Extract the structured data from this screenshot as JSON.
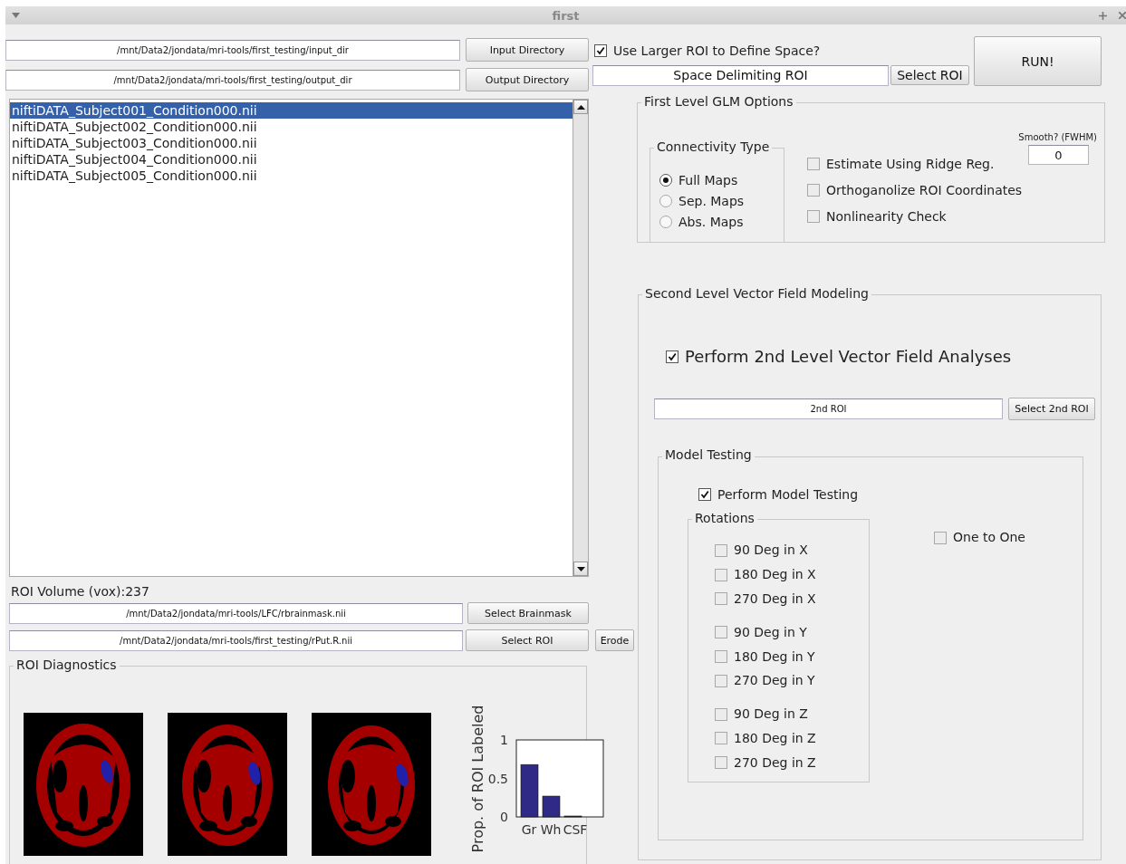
{
  "window": {
    "title": "first"
  },
  "input_dir": {
    "value": "/mnt/Data2/jondata/mri-tools/first_testing/input_dir",
    "button": "Input Directory"
  },
  "output_dir": {
    "value": "/mnt/Data2/jondata/mri-tools/first_testing/output_dir",
    "button": "Output Directory"
  },
  "file_list": {
    "items": [
      {
        "label": "niftiDATA_Subject001_Condition000.nii",
        "selected": true
      },
      {
        "label": "niftiDATA_Subject002_Condition000.nii",
        "selected": false
      },
      {
        "label": "niftiDATA_Subject003_Condition000.nii",
        "selected": false
      },
      {
        "label": "niftiDATA_Subject004_Condition000.nii",
        "selected": false
      },
      {
        "label": "niftiDATA_Subject005_Condition000.nii",
        "selected": false
      }
    ]
  },
  "roi_volume": "ROI Volume (vox):237",
  "brainmask": {
    "value": "/mnt/Data2/jondata/mri-tools/LFC/rbrainmask.nii",
    "button": "Select Brainmask"
  },
  "roi": {
    "value": "/mnt/Data2/jondata/mri-tools/first_testing/rPut.R.nii",
    "button": "Select ROI",
    "erode_button": "Erode"
  },
  "roi_diagnostics": {
    "title": "ROI Diagnostics",
    "chart_data": {
      "type": "bar",
      "ylabel": "Prop. of ROI Labeled",
      "categories": [
        "Gr",
        "Wh",
        "CSF"
      ],
      "values": [
        0.68,
        0.27,
        0
      ],
      "ylim": [
        0,
        1
      ],
      "yticks": [
        0,
        0.5,
        1
      ]
    }
  },
  "larger_roi": {
    "label": "Use Larger ROI to Define Space?",
    "checked": true,
    "value": "Space Delimiting ROI",
    "button": "Select ROI"
  },
  "run_button": "RUN!",
  "first_level": {
    "title": "First Level GLM Options",
    "connectivity": {
      "title": "Connectivity Type",
      "options": [
        {
          "label": "Full Maps",
          "selected": true
        },
        {
          "label": "Sep. Maps",
          "selected": false
        },
        {
          "label": "Abs. Maps",
          "selected": false
        }
      ]
    },
    "options": [
      {
        "label": "Estimate Using Ridge Reg.",
        "checked": false
      },
      {
        "label": "Orthoganolize ROI Coordinates",
        "checked": false
      },
      {
        "label": "Nonlinearity Check",
        "checked": false
      }
    ],
    "smooth": {
      "label": "Smooth? (FWHM)",
      "value": "0"
    }
  },
  "second_level": {
    "title": "Second Level Vector Field Modeling",
    "perform": {
      "label": "Perform 2nd Level Vector Field Analyses",
      "checked": true
    },
    "roi_value": "2nd ROI",
    "roi_button": "Select 2nd ROI",
    "model_testing": {
      "title": "Model Testing",
      "perform": {
        "label": "Perform Model Testing",
        "checked": true
      },
      "rotations": {
        "title": "Rotations",
        "groups": [
          [
            {
              "label": "90 Deg in X",
              "checked": false
            },
            {
              "label": "180 Deg in X",
              "checked": false
            },
            {
              "label": "270 Deg in X",
              "checked": false
            }
          ],
          [
            {
              "label": "90 Deg in Y",
              "checked": false
            },
            {
              "label": "180 Deg in Y",
              "checked": false
            },
            {
              "label": "270 Deg in Y",
              "checked": false
            }
          ],
          [
            {
              "label": "90 Deg in Z",
              "checked": false
            },
            {
              "label": "180 Deg in Z",
              "checked": false
            },
            {
              "label": "270 Deg in Z",
              "checked": false
            }
          ]
        ]
      },
      "one_to_one": {
        "label": "One to One",
        "checked": false
      }
    }
  }
}
